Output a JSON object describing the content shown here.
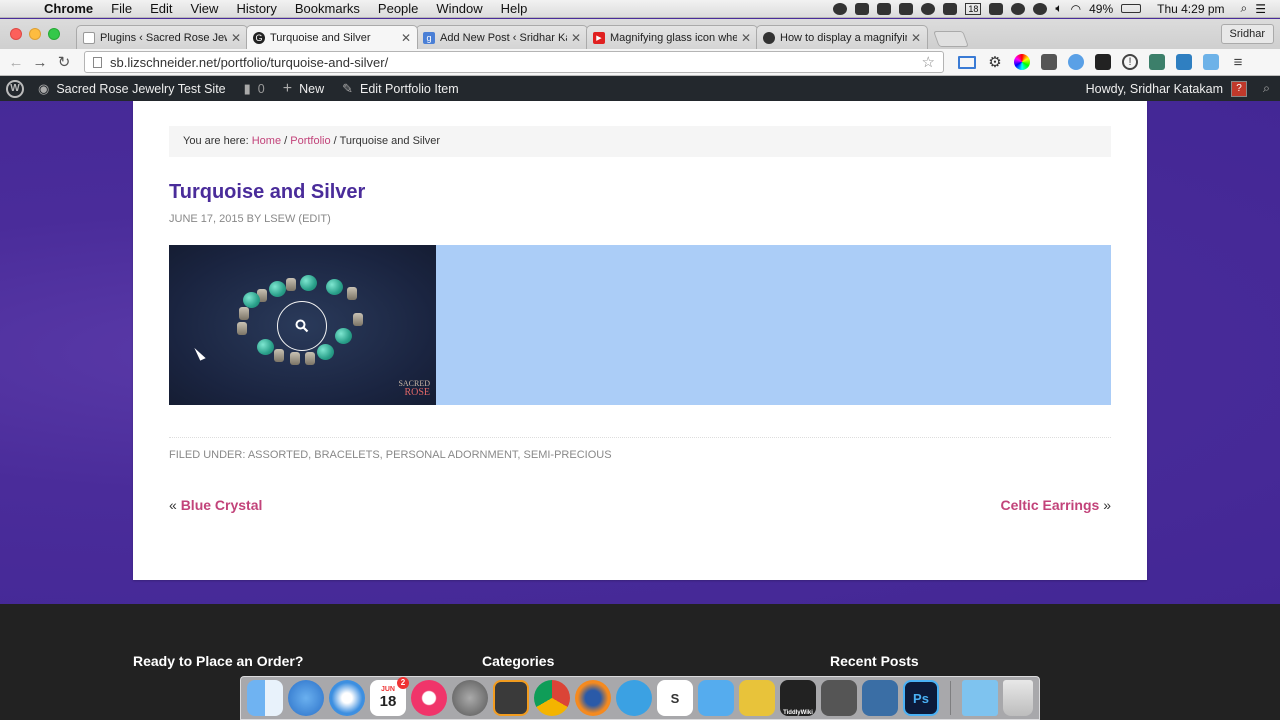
{
  "menubar": {
    "app": "Chrome",
    "items": [
      "File",
      "Edit",
      "View",
      "History",
      "Bookmarks",
      "People",
      "Window",
      "Help"
    ],
    "battery": "49%",
    "clock": "Thu 4:29 pm",
    "calendar_day": "18"
  },
  "tabs": [
    {
      "title": "Plugins ‹ Sacred Rose Jewelry",
      "fav_color": "#777777",
      "fav_glyph": ""
    },
    {
      "title": "Turquoise and Silver",
      "fav_color": "#222222",
      "fav_glyph": "G"
    },
    {
      "title": "Add New Post ‹ Sridhar Katakam",
      "fav_color": "#4a7fd6",
      "fav_glyph": "g"
    },
    {
      "title": "Magnifying glass icon when",
      "fav_color": "#e02020",
      "fav_glyph": "▶"
    },
    {
      "title": "How to display a magnifying",
      "fav_color": "#333333",
      "fav_glyph": "●"
    }
  ],
  "profile": "Sridhar",
  "address": {
    "url": "sb.lizschneider.net/portfolio/turquoise-and-silver/"
  },
  "adminbar": {
    "site": "Sacred Rose Jewelry Test Site",
    "comments": "0",
    "new": "New",
    "edit": "Edit Portfolio Item",
    "howdy": "Howdy, Sridhar Katakam"
  },
  "breadcrumb": {
    "prefix": "You are here:",
    "home": "Home",
    "sep1": "/",
    "portfolio": "Portfolio",
    "sep2": "/",
    "current": "Turquoise and Silver"
  },
  "post": {
    "title": "Turquoise and Silver",
    "meta": "June 17, 2015 by lsew (Edit)",
    "filed": "Filed Under: Assorted, Bracelets, Personal Adornment, Semi-precious",
    "watermark_line1": "SACRED",
    "watermark_line2": "ROSE"
  },
  "post_nav": {
    "prev_quote": "«",
    "prev": "Blue Crystal",
    "next": "Celtic Earrings",
    "next_quote": "»"
  },
  "footer": {
    "col1": "Ready to Place an Order?",
    "col2": "Categories",
    "col3": "Recent Posts"
  },
  "dock": {
    "calendar_month": "JUN",
    "calendar_day": "18",
    "calendar_badge": "2",
    "photoshop": "Ps",
    "tiddlywiki": "TiddlyWiki"
  },
  "colors": {
    "brand_purple": "#4a2c9a",
    "link_pink": "#c2437a",
    "gallery_blue": "#abcdf7"
  }
}
